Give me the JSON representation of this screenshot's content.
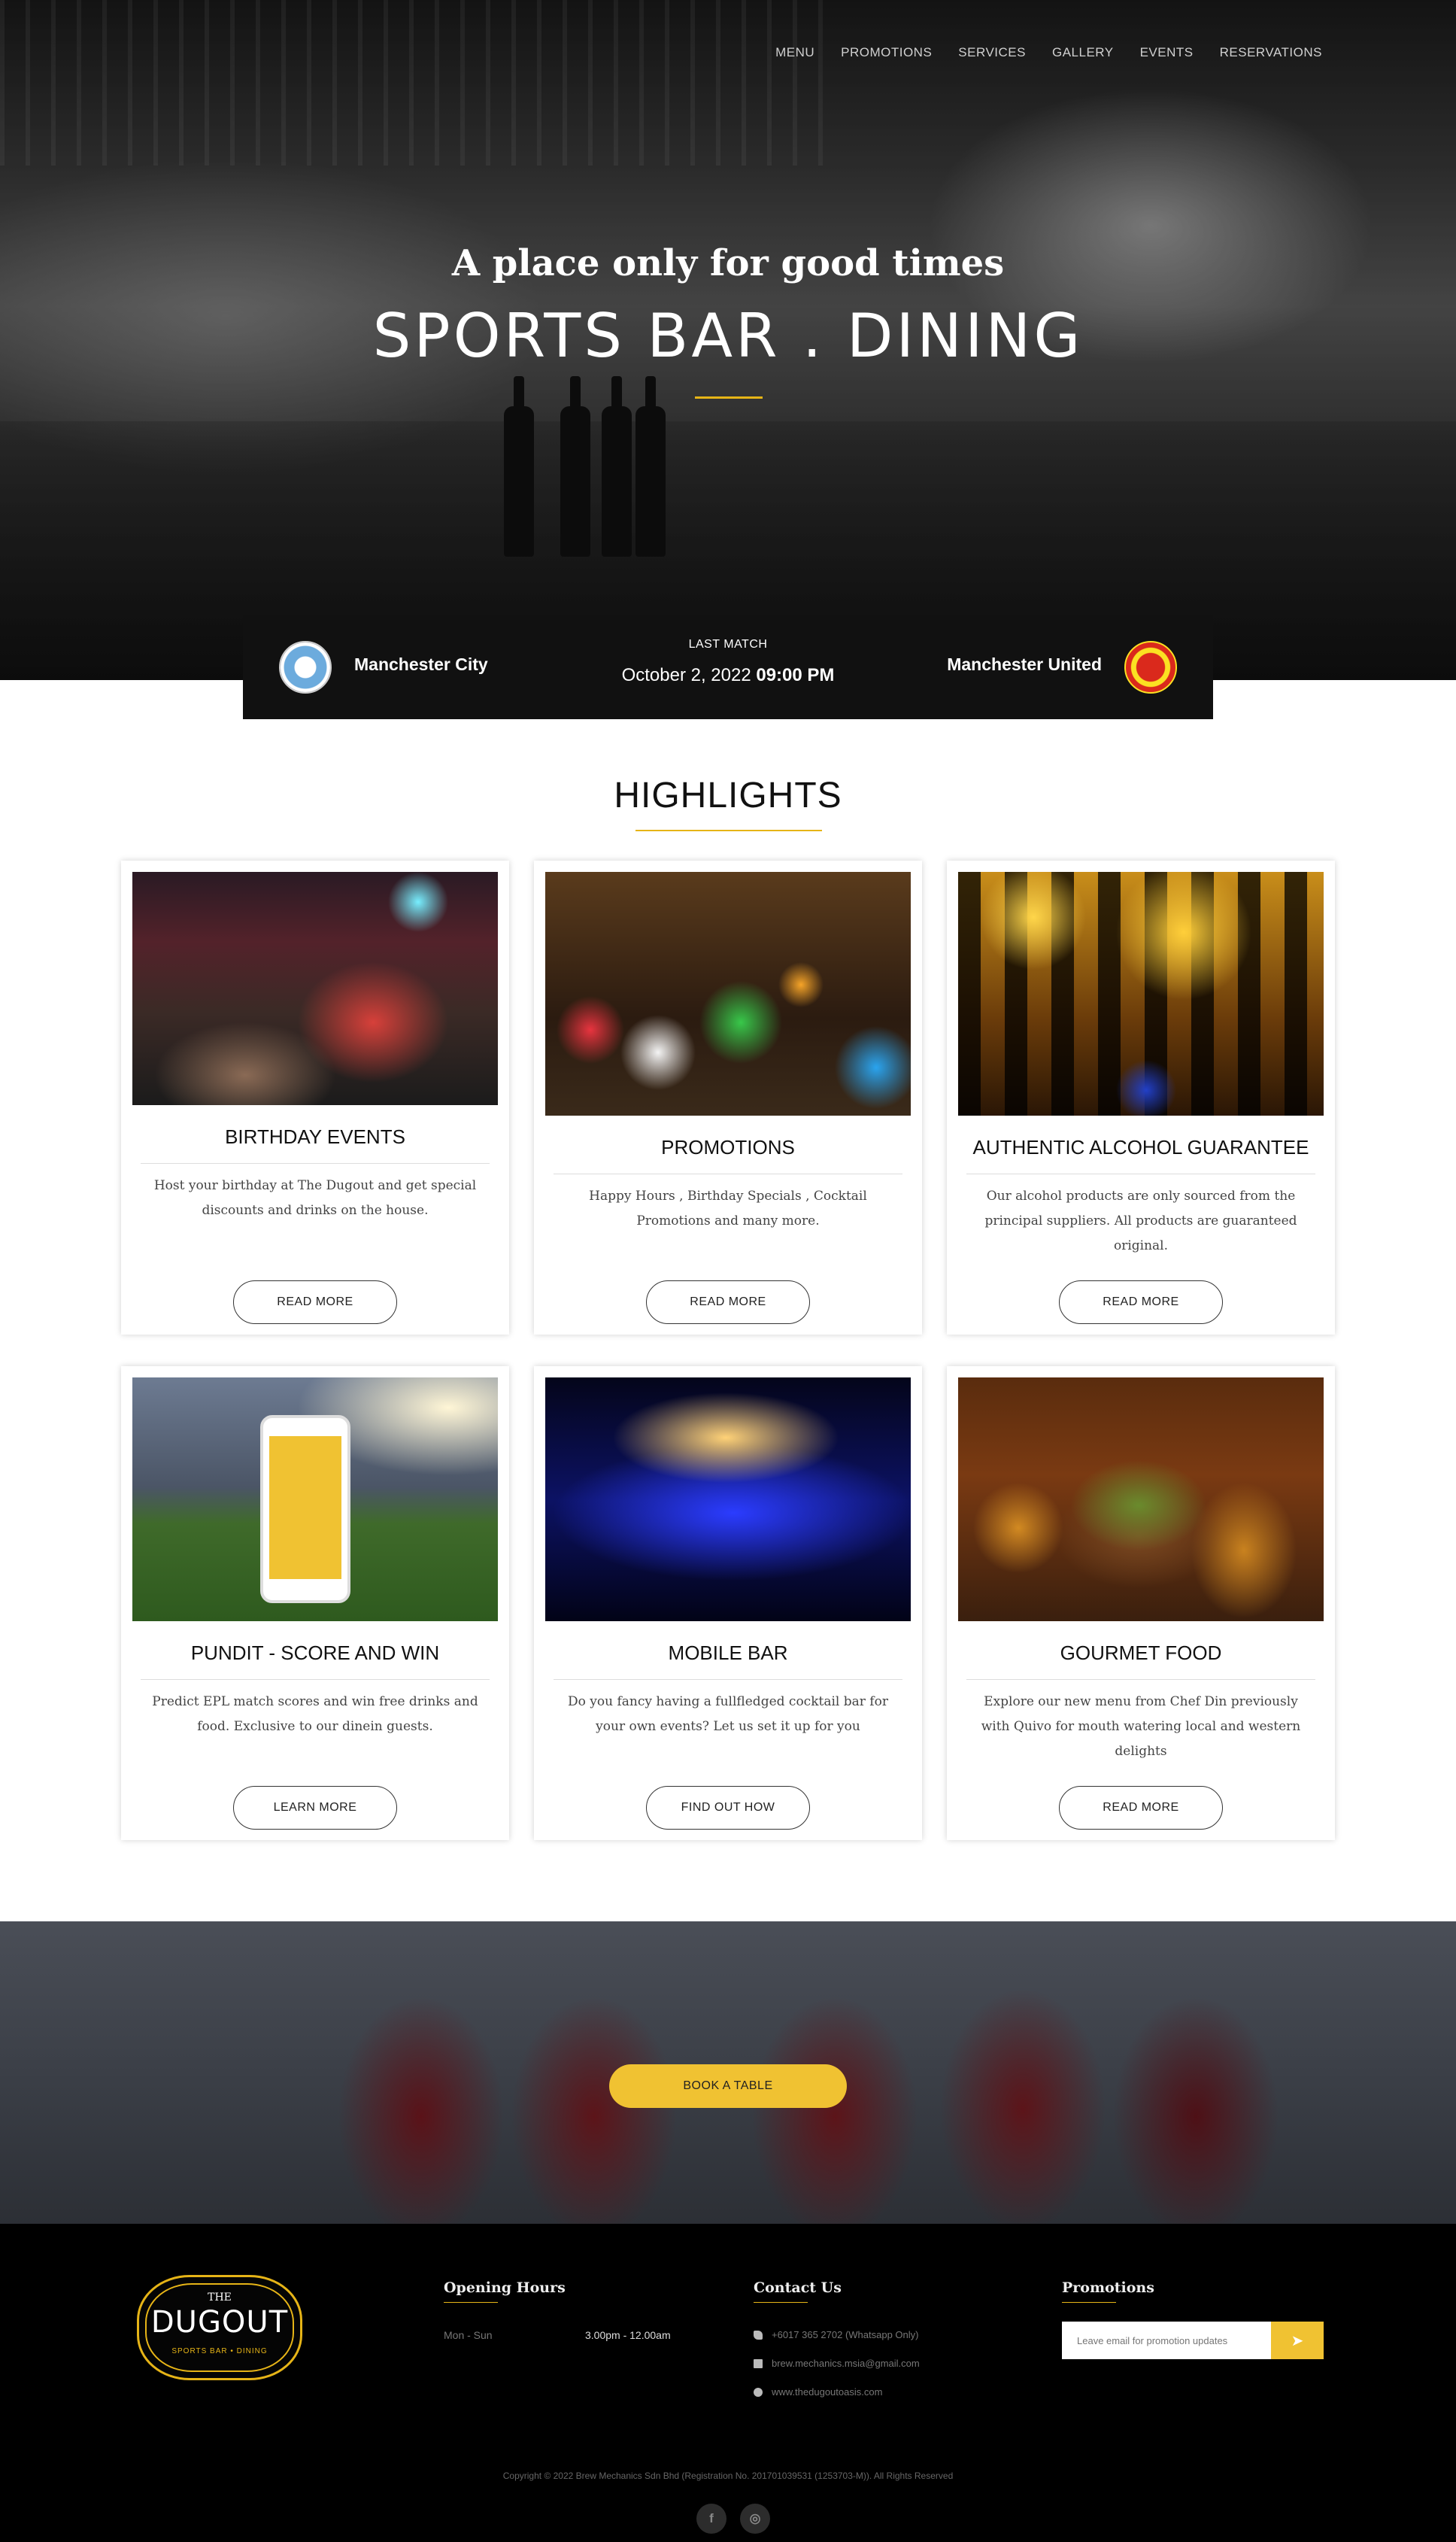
{
  "nav": {
    "items": [
      {
        "label": "MENU"
      },
      {
        "label": "PROMOTIONS"
      },
      {
        "label": "SERVICES"
      },
      {
        "label": "GALLERY"
      },
      {
        "label": "EVENTS"
      },
      {
        "label": "RESERVATIONS"
      }
    ]
  },
  "hero": {
    "tagline": "A place only for good times",
    "headline": "SPORTS BAR . DINING"
  },
  "match": {
    "label": "LAST MATCH",
    "date": "October 2, 2022",
    "time": "09:00 PM",
    "home_team": "Manchester City",
    "away_team": "Manchester United"
  },
  "highlights": {
    "title": "HIGHLIGHTS",
    "cards": [
      {
        "title": "BIRTHDAY EVENTS",
        "text": "Host your birthday at The Dugout and get special discounts and drinks on the house.",
        "button": "READ MORE"
      },
      {
        "title": "PROMOTIONS",
        "text": "Happy Hours , Birthday Specials , Cocktail Promotions and many more.",
        "button": "READ MORE"
      },
      {
        "title": "AUTHENTIC ALCOHOL GUARANTEE",
        "text": "Our alcohol products are only sourced from the principal suppliers. All products are guaranteed original.",
        "button": "READ MORE"
      },
      {
        "title": "PUNDIT - SCORE AND WIN",
        "text": "Predict EPL match scores and win free drinks and food. Exclusive to our dinein guests.",
        "button": "LEARN MORE"
      },
      {
        "title": "MOBILE BAR",
        "text": "Do you fancy having a fullfledged cocktail bar for your own events? Let us set it up for you",
        "button": "FIND OUT HOW"
      },
      {
        "title": "GOURMET FOOD",
        "text": "Explore our new menu from Chef Din previously with Quivo for mouth watering local and western delights",
        "button": "READ MORE"
      }
    ]
  },
  "book": {
    "label": "BOOK A TABLE"
  },
  "footer": {
    "logo": {
      "the": "THE",
      "name": "DUGOUT",
      "sub": "SPORTS BAR • DINING"
    },
    "hours": {
      "title": "Opening Hours",
      "day": "Mon - Sun",
      "time": "3.00pm - 12.00am"
    },
    "contact": {
      "title": "Contact Us",
      "phone": "+6017 365 2702 (Whatsapp Only)",
      "email": "brew.mechanics.msia@gmail.com",
      "website": "www.thedugoutoasis.com"
    },
    "promotions": {
      "title": "Promotions",
      "placeholder": "Leave email for promotion updates",
      "submit_icon": "send-icon"
    },
    "copyright": "Copyright © 2022 Brew Mechanics Sdn Bhd (Registration No. 201701039531 (1253703-M)). All Rights Reserved",
    "social": [
      {
        "icon": "facebook-icon",
        "glyph": "f"
      },
      {
        "icon": "instagram-icon",
        "glyph": "◎"
      }
    ]
  },
  "colors": {
    "accent": "#e6b417",
    "button_yellow": "#f0c232",
    "footer_bg": "#000000",
    "match_bg": "#111111"
  }
}
